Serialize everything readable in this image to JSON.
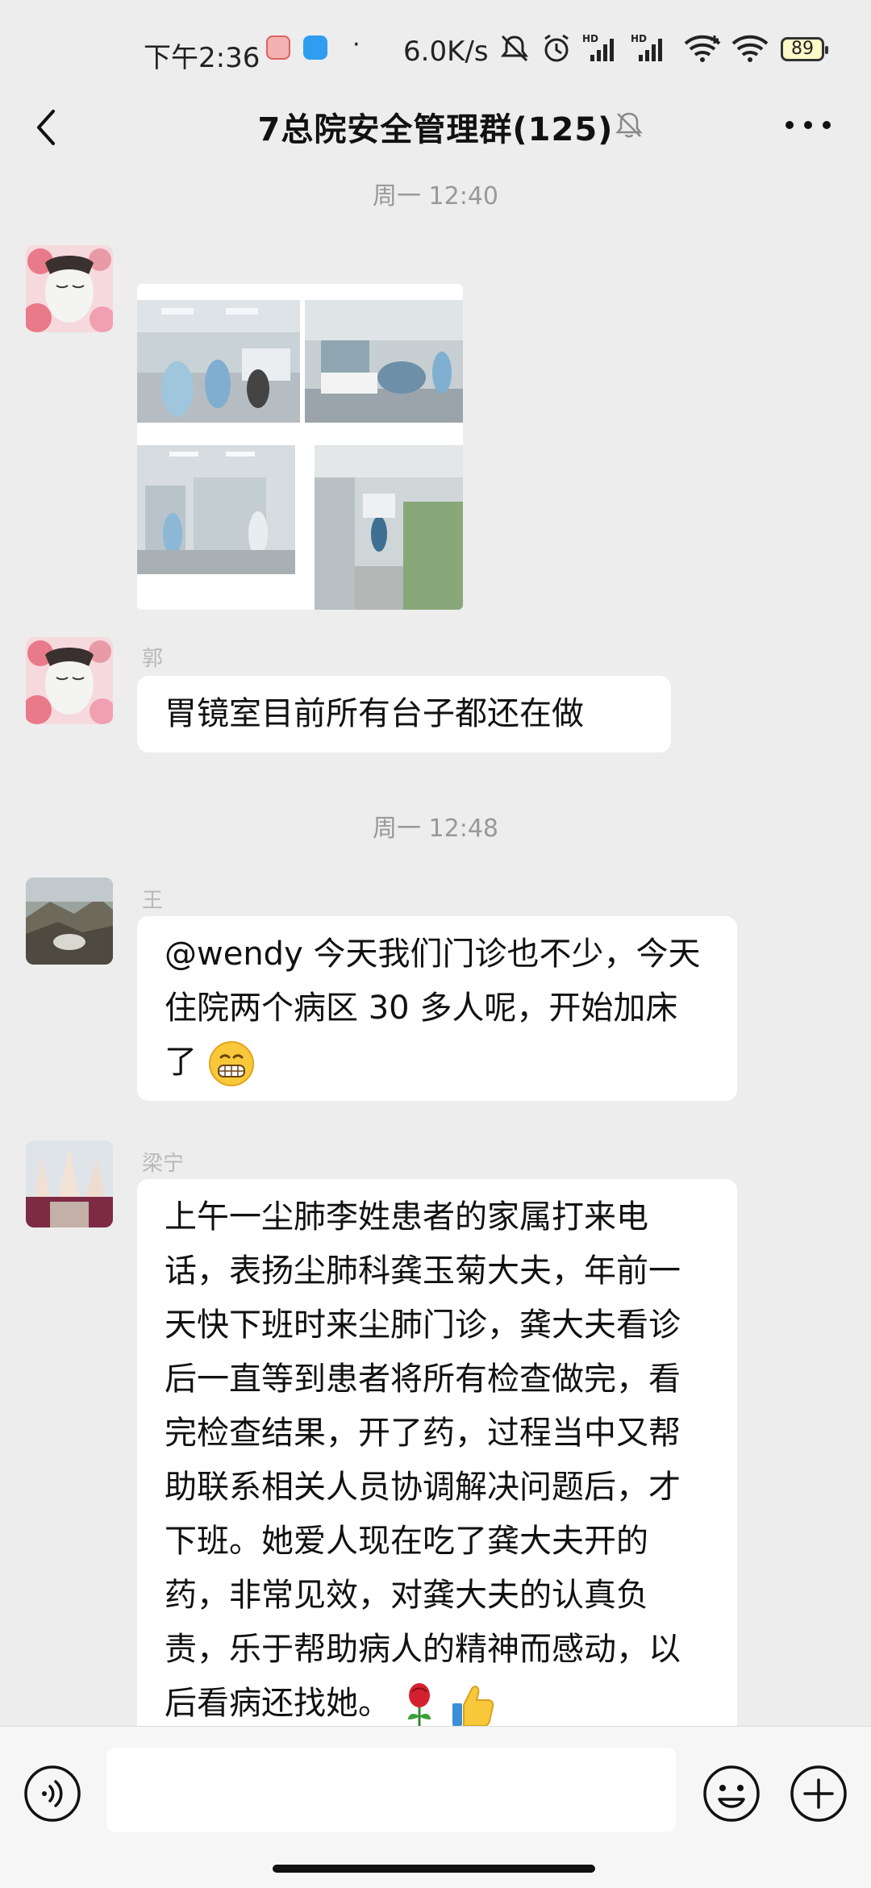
{
  "status_bar": {
    "time": "下午2:36",
    "dot": "·",
    "net_speed": "6.0K/s",
    "battery": "89",
    "icons": [
      "app-notification-icon",
      "cloud-app-icon",
      "mute-bell-icon",
      "alarm-icon",
      "hd-signal-icon",
      "hd-signal-icon",
      "wifi-plus-icon",
      "wifi-icon"
    ]
  },
  "header": {
    "title": "7总院安全管理群(125)",
    "back_icon": "chevron-left-icon",
    "mute_icon": "bell-off-icon",
    "more_icon": "more-dots-icon"
  },
  "messages": {
    "ts1": "周一 12:40",
    "msg2": {
      "sender": "郭",
      "text": "胃镜室目前所有台子都还在做"
    },
    "ts2": "周一 12:48",
    "msg3": {
      "sender": "王",
      "text": "@wendy 今天我们门诊也不少，今天住院两个病区 30 多人呢，开始加床了",
      "emoji": "grinning-emoji"
    },
    "msg4": {
      "sender": "梁宁",
      "text": "上午一尘肺李姓患者的家属打来电话，表扬尘肺科龚玉菊大夫，年前一天快下班时来尘肺门诊，龚大夫看诊后一直等到患者将所有检查做完，看完检查结果，开了药，过程当中又帮助联系相关人员协调解决问题后，才下班。她爱人现在吃了龚大夫开的药，非常见效，对龚大夫的认真负责，乐于帮助病人的精神而感动，以后看病还找她。",
      "emojis": [
        "rose-emoji",
        "thumbs-up-emoji"
      ]
    }
  },
  "input_bar": {
    "voice_icon": "voice-icon",
    "emoji_icon": "emoji-icon",
    "plus_icon": "plus-icon",
    "value": ""
  }
}
